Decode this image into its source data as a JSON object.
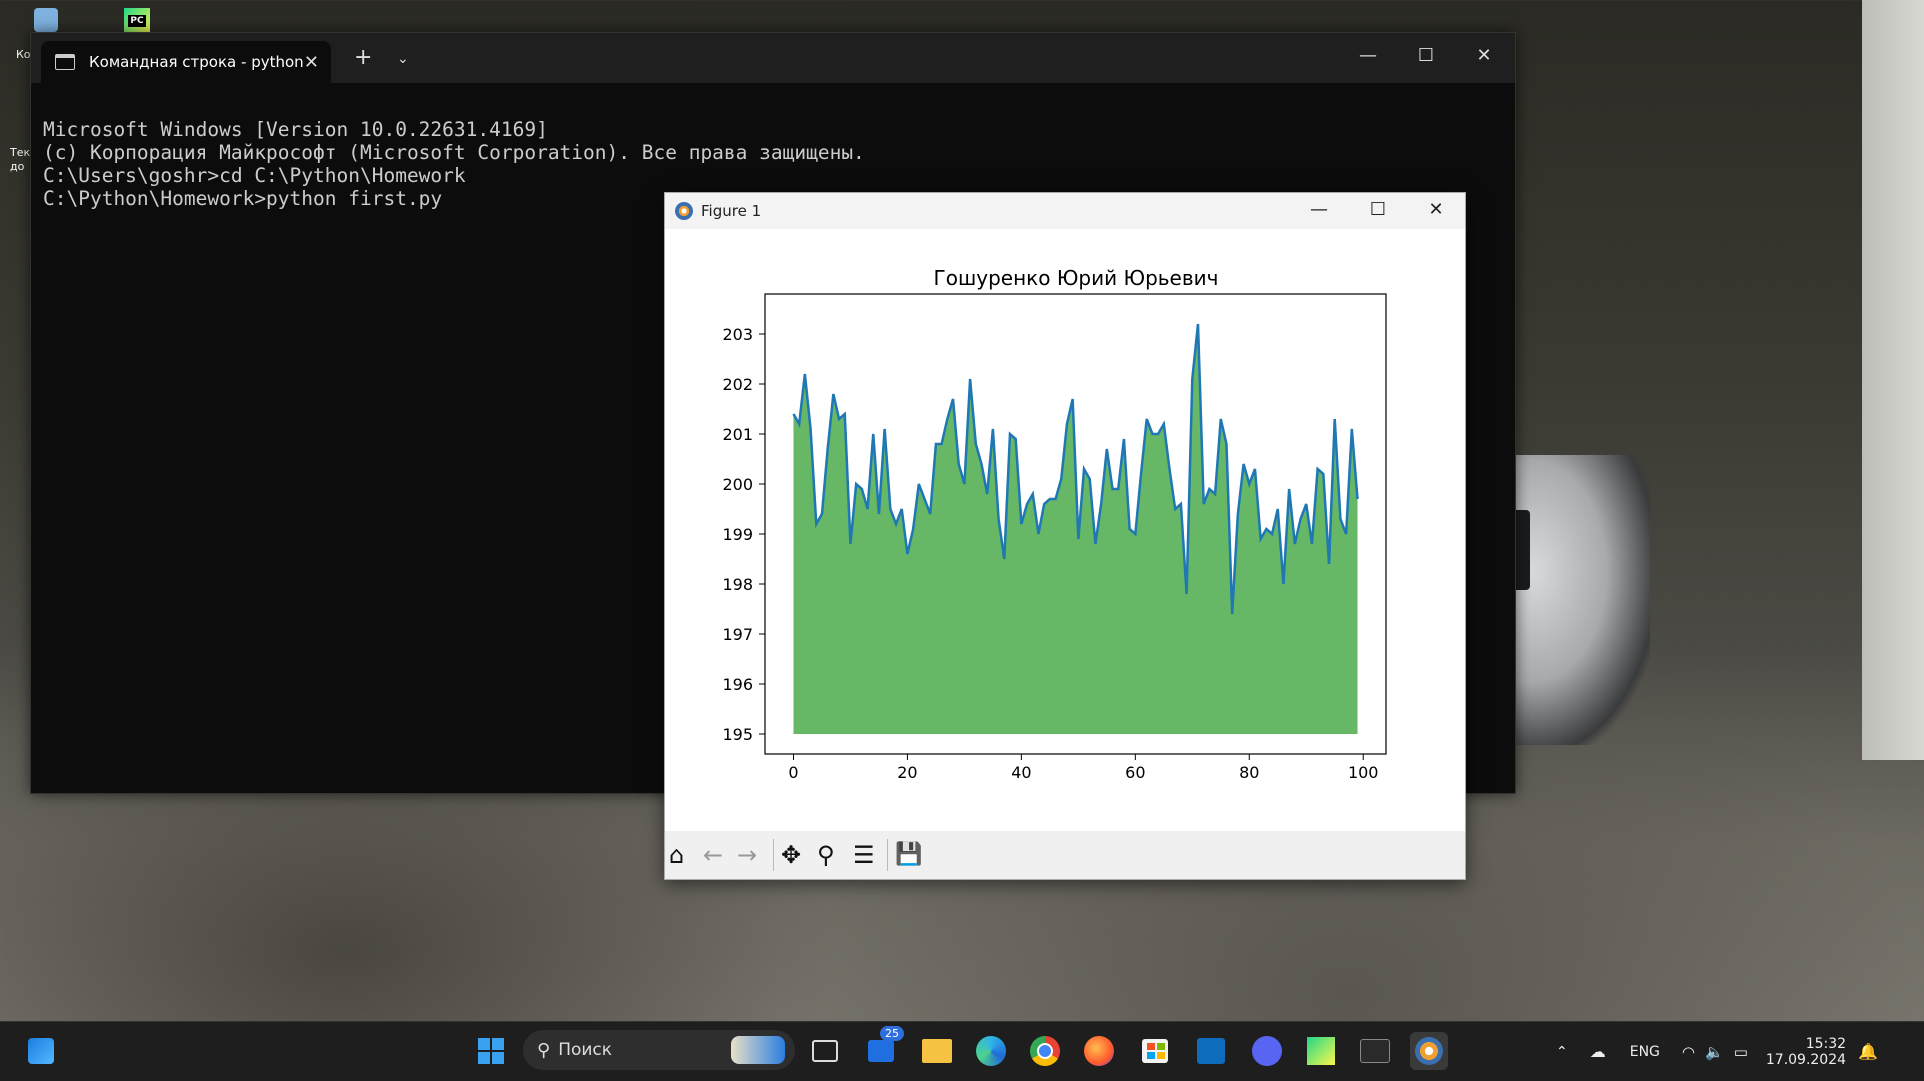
{
  "desktop": {
    "icon1_label": "Ко",
    "icon2_label": "Тек до",
    "pycharm_badge": "PC"
  },
  "terminal": {
    "tab_title": "Командная строка - python",
    "new_tab": "+",
    "dropdown": "⌄",
    "close_tab": "✕",
    "minimize": "—",
    "maximize": "☐",
    "close": "✕",
    "lines": [
      "Microsoft Windows [Version 10.0.22631.4169]",
      "(c) Корпорация Майкрософт (Microsoft Corporation). Все права защищены.",
      "",
      "C:\\Users\\goshr>cd C:\\Python\\Homework",
      "",
      "C:\\Python\\Homework>python first.py"
    ]
  },
  "figure": {
    "title": "Figure 1",
    "minimize": "—",
    "maximize": "☐",
    "close": "✕",
    "toolbar": {
      "home": "⌂",
      "back": "←",
      "forward": "→",
      "pan": "✥",
      "zoom": "⚲",
      "configure": "☰",
      "save": "💾"
    }
  },
  "chart_data": {
    "type": "area",
    "title": "Гошуренко Юрий Юрьевич",
    "xlabel": "",
    "ylabel": "",
    "xlim": [
      -5,
      104
    ],
    "ylim": [
      194.6,
      203.8
    ],
    "xticks": [
      0,
      20,
      40,
      60,
      80,
      100
    ],
    "yticks": [
      195,
      196,
      197,
      198,
      199,
      200,
      201,
      202,
      203
    ],
    "fill_base": 195,
    "fill_color": "#66b866",
    "line_color": "#1f77b4",
    "series": [
      {
        "x": [
          0,
          1,
          2,
          3,
          4,
          5,
          6,
          7,
          8,
          9,
          10,
          11,
          12,
          13,
          14,
          15,
          16,
          17,
          18,
          19,
          20,
          21,
          22,
          23,
          24,
          25,
          26,
          27,
          28,
          29,
          30,
          31,
          32,
          33,
          34,
          35,
          36,
          37,
          38,
          39,
          40,
          41,
          42,
          43,
          44,
          45,
          46,
          47,
          48,
          49,
          50,
          51,
          52,
          53,
          54,
          55,
          56,
          57,
          58,
          59,
          60,
          61,
          62,
          63,
          64,
          65,
          66,
          67,
          68,
          69,
          70,
          71,
          72,
          73,
          74,
          75,
          76,
          77,
          78,
          79,
          80,
          81,
          82,
          83,
          84,
          85,
          86,
          87,
          88,
          89,
          90,
          91,
          92,
          93,
          94,
          95,
          96,
          97,
          98,
          99
        ],
        "values": [
          201.4,
          201.2,
          202.2,
          201.1,
          199.2,
          199.4,
          200.7,
          201.8,
          201.3,
          201.4,
          198.8,
          200.0,
          199.9,
          199.5,
          201.0,
          199.4,
          201.1,
          199.5,
          199.2,
          199.5,
          198.6,
          199.1,
          200.0,
          199.7,
          199.4,
          200.8,
          200.8,
          201.3,
          201.7,
          200.4,
          200.0,
          202.1,
          200.8,
          200.4,
          199.8,
          201.1,
          199.3,
          198.5,
          201.0,
          200.9,
          199.2,
          199.6,
          199.8,
          199.0,
          199.6,
          199.7,
          199.7,
          200.1,
          201.2,
          201.7,
          198.9,
          200.3,
          200.1,
          198.8,
          199.6,
          200.7,
          199.9,
          199.9,
          200.9,
          199.1,
          199.0,
          200.2,
          201.3,
          201.0,
          201.0,
          201.2,
          200.3,
          199.5,
          199.6,
          197.8,
          202.1,
          203.2,
          199.6,
          199.9,
          199.8,
          201.3,
          200.8,
          197.4,
          199.4,
          200.4,
          200.0,
          200.3,
          198.9,
          199.1,
          199.0,
          199.5,
          198.0,
          199.9,
          198.8,
          199.3,
          199.6,
          198.8,
          200.3,
          200.2,
          198.4,
          201.3,
          199.3,
          199.0,
          201.1,
          199.7
        ]
      }
    ],
    "grid": false
  },
  "taskbar": {
    "search_label": "Поиск",
    "mail_badge": "25",
    "language": "ENG",
    "time": "15:32",
    "date": "17.09.2024"
  }
}
